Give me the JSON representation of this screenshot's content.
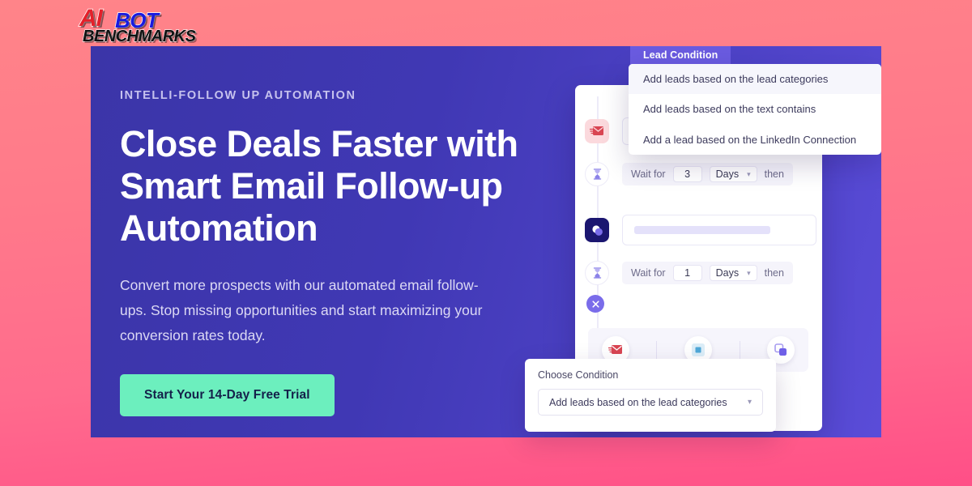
{
  "logo": {
    "part1": "AI",
    "part2": "BOT",
    "part3": "BENCHMARKS",
    "colors": {
      "ai": "#E5202A",
      "bot": "#1A1AE0",
      "benchmarks": "#111111"
    }
  },
  "hero": {
    "eyebrow": "INTELLI-FOLLOW UP AUTOMATION",
    "headline": "Close Deals Faster with Smart Email Follow-up Automation",
    "subcopy": "Convert more prospects with our automated email follow-ups. Stop missing opportunities and start maximizing your conversion rates today.",
    "cta_label": "Start Your 14-Day Free Trial",
    "background_color": "#4038B4",
    "cta_color": "#6CEFBE"
  },
  "mock": {
    "lead_tab_label": "Lead Condition",
    "dropdown": {
      "items": [
        "Add leads based on the lead categories",
        "Add leads based on the text contains",
        "Add a lead based on the LinkedIn Connection"
      ],
      "active_index": 0
    },
    "steps": [
      {
        "icon": "email-icon",
        "type": "email"
      },
      {
        "icon": "hourglass-icon",
        "type": "wait",
        "wait_label": "Wait for",
        "value": "3",
        "unit": "Days",
        "then_label": "then"
      },
      {
        "icon": "duplicate-icon",
        "type": "input"
      },
      {
        "icon": "hourglass-icon",
        "type": "wait",
        "wait_label": "Wait for",
        "value": "1",
        "unit": "Days",
        "then_label": "then"
      },
      {
        "icon": "close-circle-icon",
        "type": "remove"
      }
    ],
    "toolbar_icons": [
      "email-icon",
      "stop-square-icon",
      "duplicate-icon"
    ]
  },
  "choose_condition": {
    "label": "Choose Condition",
    "selected_value": "Add leads based on the lead categories"
  }
}
